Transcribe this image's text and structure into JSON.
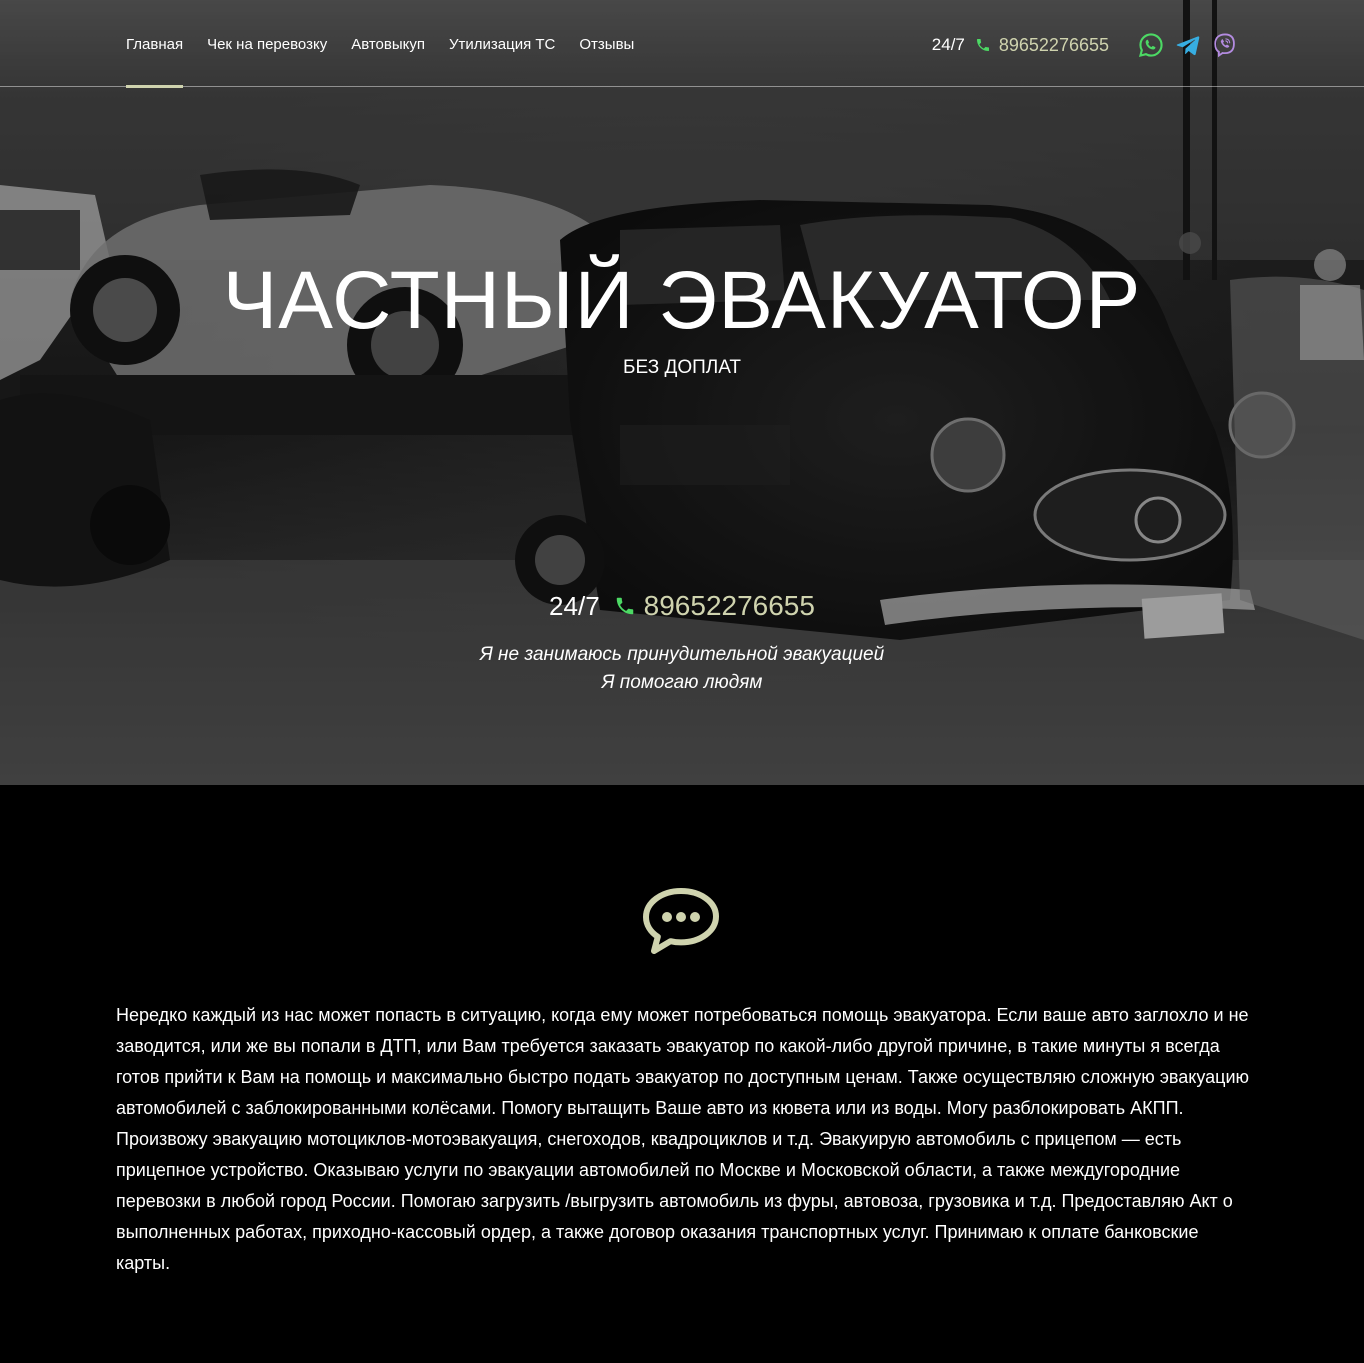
{
  "nav": {
    "items": [
      {
        "label": "Главная",
        "active": true
      },
      {
        "label": "Чек на перевозку",
        "active": false
      },
      {
        "label": "Автовыкуп",
        "active": false
      },
      {
        "label": "Утилизация ТС",
        "active": false
      },
      {
        "label": "Отзывы",
        "active": false
      }
    ],
    "hours": "24/7",
    "phone": "89652276655",
    "messengers": [
      "whatsapp-icon",
      "telegram-icon",
      "viber-icon"
    ]
  },
  "hero": {
    "title": "ЧАСТНЫЙ ЭВАКУАТОР",
    "subtitle": "БЕЗ ДОПЛАТ",
    "hours": "24/7",
    "phone": "89652276655",
    "note_line1": "Я не занимаюсь принудительной эвакуацией",
    "note_line2": "Я помогаю людям"
  },
  "about": {
    "icon": "chat-bubble-icon",
    "text": "Нередко каждый из нас может попасть в ситуацию, когда ему может потребоваться помощь эвакуатора.  Если ваше авто заглохло и не заводится, или же вы попали в ДТП, или Вам требуется заказать эвакуатор по какой-либо другой причине, в такие минуты я всегда готов прийти к Вам на помощь и максимально быстро подать эвакуатор по доступным ценам. Также осуществляю сложную эвакуацию автомобилей с заблокированными колёсами.  Помогу вытащить Ваше авто из кювета или из воды. Могу разблокировать АКПП. Произвожу эвакуацию мотоциклов-мотоэвакуация, снегоходов, квадроциклов и т.д. Эвакуирую автомобиль с прицепом — есть прицепное устройство. Оказываю услуги по эвакуации автомобилей по Москве и Московской области, а также междугородние перевозки в любой город  России. Помогаю  загрузить /выгрузить автомобиль  из фуры, автовоза, грузовика и т.д.  Предоставляю Акт о выполненных работах, приходно-кассовый ордер, а также договор оказания транспортных услуг. Принимаю к оплате банковские карты."
  },
  "colors": {
    "accent": "#cfd3ae",
    "phone_green": "#4cd964",
    "whatsapp": "#4cd964",
    "telegram": "#37aee2",
    "viber": "#b38be0",
    "background": "#000000"
  }
}
